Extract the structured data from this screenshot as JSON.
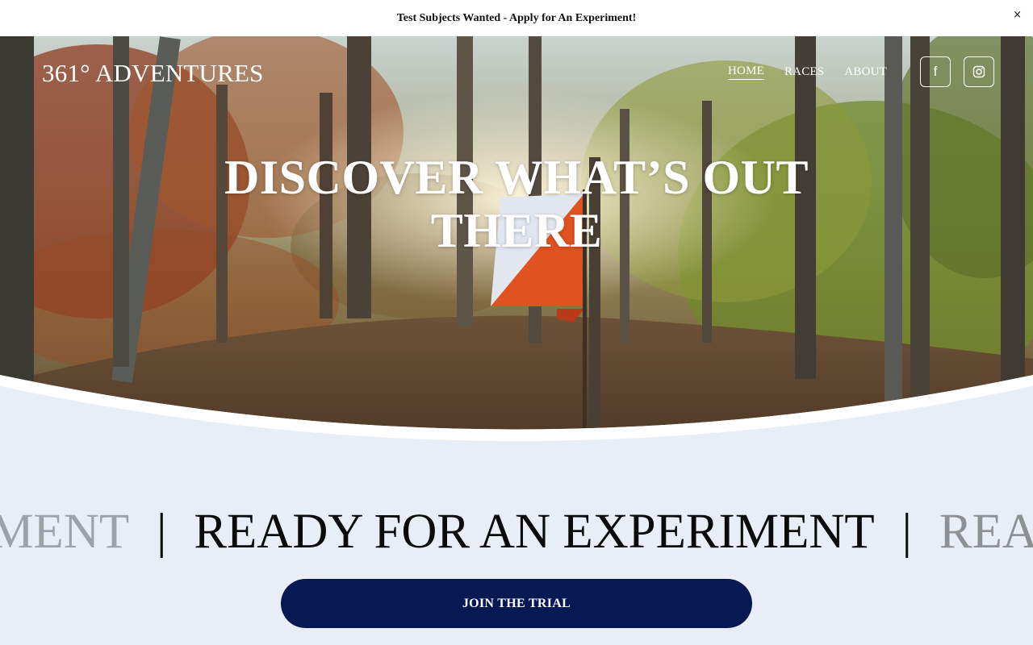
{
  "announcement": {
    "text": "Test Subjects Wanted - Apply for An Experiment!",
    "close_icon": "close-icon",
    "close_glyph": "×"
  },
  "header": {
    "logo": "361° ADVENTURES",
    "nav": [
      {
        "label": "HOME",
        "active": true
      },
      {
        "label": "RACES",
        "active": false
      },
      {
        "label": "ABOUT",
        "active": false
      }
    ],
    "social": [
      {
        "icon": "facebook-icon",
        "glyph": "f"
      },
      {
        "icon": "instagram-icon"
      }
    ]
  },
  "hero": {
    "title": "DISCOVER WHAT’S OUT THERE"
  },
  "marquee": {
    "text": "READY FOR AN EXPERIMENT",
    "left_fragment": "IMENT",
    "right_fragment": "REA",
    "separator": "|"
  },
  "cta": {
    "label": "JOIN THE TRIAL"
  },
  "colors": {
    "page_background": "#e9edf5",
    "cta_background": "#071952",
    "announcement_background": "#ffffff"
  }
}
